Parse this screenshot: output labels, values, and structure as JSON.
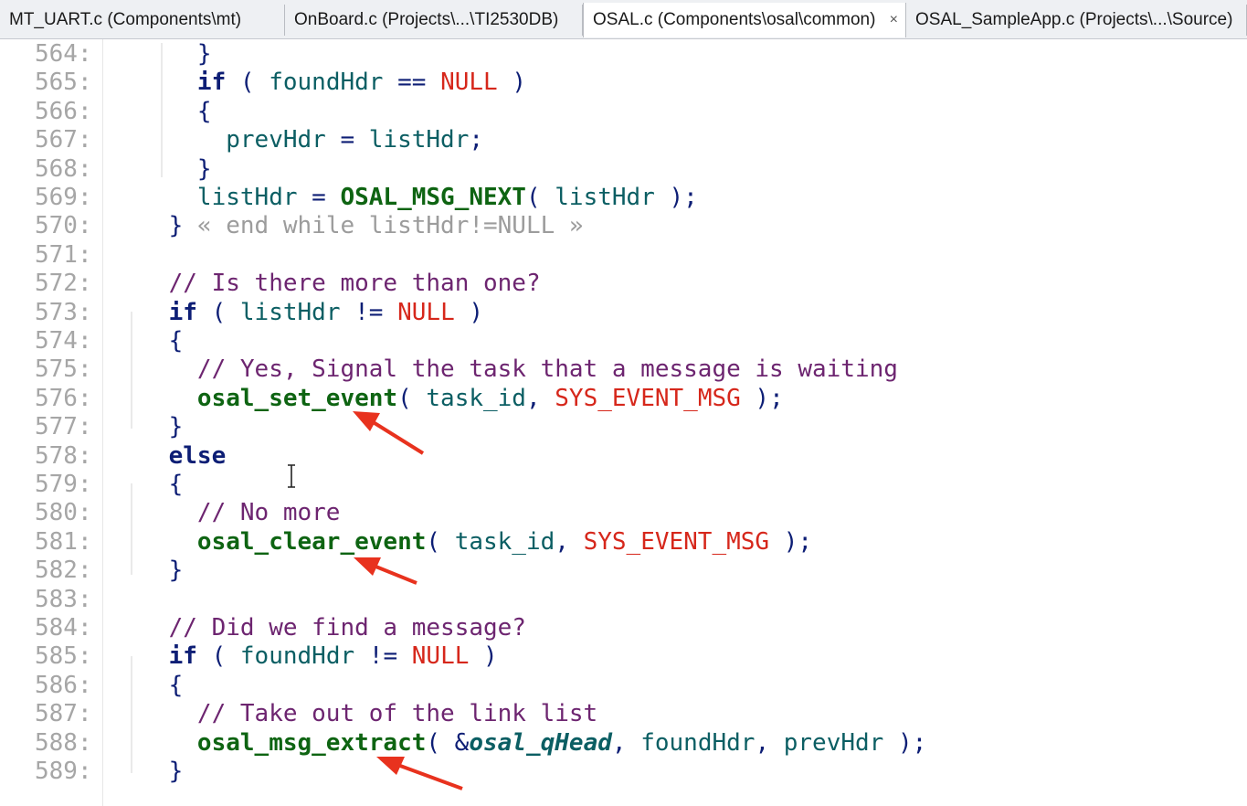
{
  "tabs": [
    {
      "label": "MT_UART.c (Components\\mt)",
      "active": false
    },
    {
      "label": "OnBoard.c (Projects\\...\\TI2530DB)",
      "active": false
    },
    {
      "label": "OSAL.c (Components\\osal\\common)",
      "active": true,
      "close_icon": "×"
    },
    {
      "label": "OSAL_SampleApp.c (Projects\\...\\Source)",
      "active": false
    }
  ],
  "lines": [
    {
      "num": "564:",
      "parts": [
        [
          "",
          "      "
        ],
        [
          "op",
          "}"
        ]
      ]
    },
    {
      "num": "565:",
      "parts": [
        [
          "",
          "      "
        ],
        [
          "kw",
          "if"
        ],
        [
          "op",
          " ( "
        ],
        [
          "id",
          "foundHdr"
        ],
        [
          "op",
          " == "
        ],
        [
          "mac",
          "NULL"
        ],
        [
          "op",
          " )"
        ]
      ]
    },
    {
      "num": "566:",
      "parts": [
        [
          "",
          "      "
        ],
        [
          "op",
          "{"
        ]
      ]
    },
    {
      "num": "567:",
      "parts": [
        [
          "",
          "        "
        ],
        [
          "id",
          "prevHdr"
        ],
        [
          "op",
          " = "
        ],
        [
          "id",
          "listHdr"
        ],
        [
          "op",
          ";"
        ]
      ]
    },
    {
      "num": "568:",
      "parts": [
        [
          "",
          "      "
        ],
        [
          "op",
          "}"
        ]
      ]
    },
    {
      "num": "569:",
      "parts": [
        [
          "",
          "      "
        ],
        [
          "id",
          "listHdr"
        ],
        [
          "op",
          " = "
        ],
        [
          "fn",
          "OSAL_MSG_NEXT"
        ],
        [
          "op",
          "( "
        ],
        [
          "id",
          "listHdr"
        ],
        [
          "op",
          " );"
        ]
      ]
    },
    {
      "num": "570:",
      "parts": [
        [
          "",
          "    "
        ],
        [
          "op",
          "}"
        ],
        [
          "fold",
          " « end while listHdr!=NULL »"
        ]
      ]
    },
    {
      "num": "571:",
      "parts": []
    },
    {
      "num": "572:",
      "parts": [
        [
          "",
          "    "
        ],
        [
          "cm",
          "// Is there more than one?"
        ]
      ]
    },
    {
      "num": "573:",
      "parts": [
        [
          "",
          "    "
        ],
        [
          "kw",
          "if"
        ],
        [
          "op",
          " ( "
        ],
        [
          "id",
          "listHdr"
        ],
        [
          "op",
          " != "
        ],
        [
          "mac",
          "NULL"
        ],
        [
          "op",
          " )"
        ]
      ]
    },
    {
      "num": "574:",
      "parts": [
        [
          "",
          "    "
        ],
        [
          "op",
          "{"
        ]
      ]
    },
    {
      "num": "575:",
      "parts": [
        [
          "",
          "      "
        ],
        [
          "cm",
          "// Yes, Signal the task that a message is waiting"
        ]
      ]
    },
    {
      "num": "576:",
      "parts": [
        [
          "",
          "      "
        ],
        [
          "fn",
          "osal_set_event"
        ],
        [
          "op",
          "( "
        ],
        [
          "id",
          "task_id"
        ],
        [
          "op",
          ", "
        ],
        [
          "mac",
          "SYS_EVENT_MSG"
        ],
        [
          "op",
          " );"
        ]
      ]
    },
    {
      "num": "577:",
      "parts": [
        [
          "",
          "    "
        ],
        [
          "op",
          "}"
        ]
      ]
    },
    {
      "num": "578:",
      "parts": [
        [
          "",
          "    "
        ],
        [
          "kw",
          "else"
        ]
      ]
    },
    {
      "num": "579:",
      "parts": [
        [
          "",
          "    "
        ],
        [
          "op",
          "{"
        ]
      ]
    },
    {
      "num": "580:",
      "parts": [
        [
          "",
          "      "
        ],
        [
          "cm",
          "// No more"
        ]
      ]
    },
    {
      "num": "581:",
      "parts": [
        [
          "",
          "      "
        ],
        [
          "fn",
          "osal_clear_event"
        ],
        [
          "op",
          "( "
        ],
        [
          "id",
          "task_id"
        ],
        [
          "op",
          ", "
        ],
        [
          "mac",
          "SYS_EVENT_MSG"
        ],
        [
          "op",
          " );"
        ]
      ]
    },
    {
      "num": "582:",
      "parts": [
        [
          "",
          "    "
        ],
        [
          "op",
          "}"
        ]
      ]
    },
    {
      "num": "583:",
      "parts": []
    },
    {
      "num": "584:",
      "parts": [
        [
          "",
          "    "
        ],
        [
          "cm",
          "// Did we find a message?"
        ]
      ]
    },
    {
      "num": "585:",
      "parts": [
        [
          "",
          "    "
        ],
        [
          "kw",
          "if"
        ],
        [
          "op",
          " ( "
        ],
        [
          "id",
          "foundHdr"
        ],
        [
          "op",
          " != "
        ],
        [
          "mac",
          "NULL"
        ],
        [
          "op",
          " )"
        ]
      ]
    },
    {
      "num": "586:",
      "parts": [
        [
          "",
          "    "
        ],
        [
          "op",
          "{"
        ]
      ]
    },
    {
      "num": "587:",
      "parts": [
        [
          "",
          "      "
        ],
        [
          "cm",
          "// Take out of the link list"
        ]
      ]
    },
    {
      "num": "588:",
      "parts": [
        [
          "",
          "      "
        ],
        [
          "fn",
          "osal_msg_extract"
        ],
        [
          "op",
          "( &"
        ],
        [
          "it",
          "osal_qHead"
        ],
        [
          "op",
          ", "
        ],
        [
          "id",
          "foundHdr"
        ],
        [
          "op",
          ", "
        ],
        [
          "id",
          "prevHdr"
        ],
        [
          "op",
          " );"
        ]
      ]
    },
    {
      "num": "589:",
      "parts": [
        [
          "",
          "    "
        ],
        [
          "op",
          "}"
        ]
      ]
    }
  ],
  "annotations": {
    "arrow_color": "#e8321e"
  }
}
